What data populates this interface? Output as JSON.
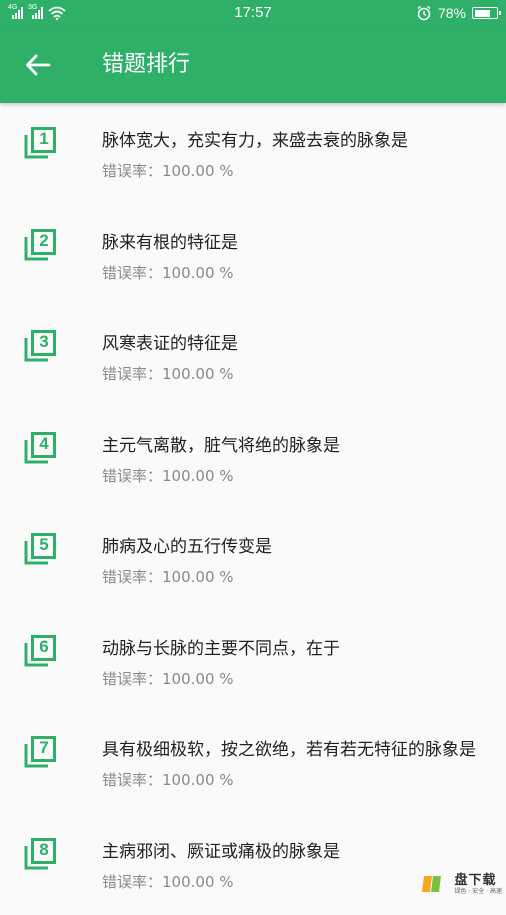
{
  "status_bar": {
    "signal_1_tag": "4G",
    "signal_2_tag": "3G",
    "time": "17:57",
    "battery": "78%",
    "battery_level": 0.78
  },
  "app_bar": {
    "back_icon": "arrow-left-icon",
    "title": "错题排行"
  },
  "items": [
    {
      "rank": "1",
      "title": "脉体宽大，充实有力，来盛去衰的脉象是",
      "rate_label": "错误率：",
      "rate_value": "100.00 %"
    },
    {
      "rank": "2",
      "title": "脉来有根的特征是",
      "rate_label": "错误率：",
      "rate_value": "100.00 %"
    },
    {
      "rank": "3",
      "title": "风寒表证的特征是",
      "rate_label": "错误率：",
      "rate_value": "100.00 %"
    },
    {
      "rank": "4",
      "title": "主元气离散，脏气将绝的脉象是",
      "rate_label": "错误率：",
      "rate_value": "100.00 %"
    },
    {
      "rank": "5",
      "title": "肺病及心的五行传变是",
      "rate_label": "错误率：",
      "rate_value": "100.00 %"
    },
    {
      "rank": "6",
      "title": "动脉与长脉的主要不同点，在于",
      "rate_label": "错误率：",
      "rate_value": "100.00 %"
    },
    {
      "rank": "7",
      "title": "具有极细极软，按之欲绝，若有若无特征的脉象是",
      "rate_label": "错误率：",
      "rate_value": "100.00 %"
    },
    {
      "rank": "8",
      "title": "主病邪闭、厥证或痛极的脉象是",
      "rate_label": "错误率：",
      "rate_value": "100.00 %"
    }
  ],
  "watermark": {
    "logo_char": "K",
    "main": "盘下载",
    "sub": "绿色 · 安全 · 高速"
  },
  "colors": {
    "primary": "#2fb069",
    "title_text": "#222222",
    "secondary_text": "#8a8a8a",
    "background": "#fafafa"
  }
}
